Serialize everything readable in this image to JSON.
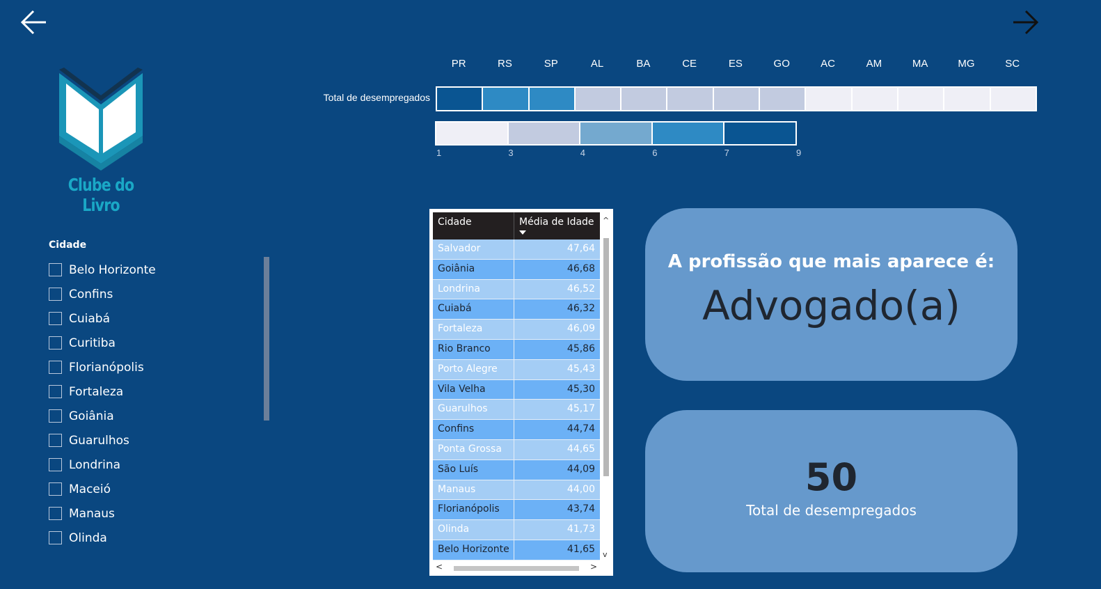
{
  "navigation": {
    "back_icon": "arrow-left-icon",
    "next_icon": "arrow-right-icon"
  },
  "logo": {
    "text": "Clube do Livro",
    "colors": {
      "book_outer": "#1b96b8",
      "book_inner": "#ffffff",
      "book_dark": "#12334f"
    }
  },
  "slicer": {
    "title": "Cidade",
    "items": [
      "Belo Horizonte",
      "Confins",
      "Cuiabá",
      "Curitiba",
      "Florianópolis",
      "Fortaleza",
      "Goiânia",
      "Guarulhos",
      "Londrina",
      "Maceió",
      "Manaus",
      "Olinda"
    ]
  },
  "heatmap": {
    "row_label": "Total de desempregados",
    "columns": [
      "PR",
      "RS",
      "SP",
      "AL",
      "BA",
      "CE",
      "ES",
      "GO",
      "AC",
      "AM",
      "MA",
      "MG",
      "SC"
    ],
    "cell_colors": [
      "#0a5592",
      "#2e8ac4",
      "#2e8ac4",
      "#c2cbe0",
      "#c2cbe0",
      "#c2cbe0",
      "#c2cbe0",
      "#c2cbe0",
      "#efeff6",
      "#efeff6",
      "#efeff6",
      "#efeff6",
      "#efeff6"
    ],
    "legend": {
      "ticks": [
        "1",
        "3",
        "4",
        "6",
        "7",
        "9"
      ],
      "swatch_colors": [
        "#efeff6",
        "#c2cbe0",
        "#74a9cf",
        "#2e8ac4",
        "#0a5592"
      ]
    }
  },
  "table": {
    "headers": {
      "city": "Cidade",
      "age": "Média de Idade"
    },
    "rows": [
      {
        "city": "Salvador",
        "age": "47,64"
      },
      {
        "city": "Goiânia",
        "age": "46,68"
      },
      {
        "city": "Londrina",
        "age": "46,52"
      },
      {
        "city": "Cuiabá",
        "age": "46,32"
      },
      {
        "city": "Fortaleza",
        "age": "46,09"
      },
      {
        "city": "Rio Branco",
        "age": "45,86"
      },
      {
        "city": "Porto Alegre",
        "age": "45,43"
      },
      {
        "city": "Vila Velha",
        "age": "45,30"
      },
      {
        "city": "Guarulhos",
        "age": "45,17"
      },
      {
        "city": "Confins",
        "age": "44,74"
      },
      {
        "city": "Ponta Grossa",
        "age": "44,65"
      },
      {
        "city": "São Luís",
        "age": "44,09"
      },
      {
        "city": "Manaus",
        "age": "44,00"
      },
      {
        "city": "Florianópolis",
        "age": "43,74"
      },
      {
        "city": "Olinda",
        "age": "41,73"
      },
      {
        "city": "Belo Horizonte",
        "age": "41,65"
      }
    ]
  },
  "cards": {
    "profession": {
      "subtitle": "A profissão que mais aparece é:",
      "value": "Advogado(a)"
    },
    "total": {
      "value": "50",
      "caption": "Total de desempregados"
    }
  }
}
